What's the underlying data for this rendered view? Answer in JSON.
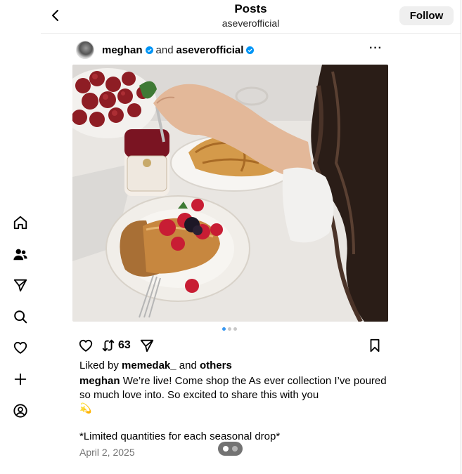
{
  "header": {
    "title": "Posts",
    "subtitle": "aseverofficial",
    "follow_label": "Follow"
  },
  "sidebar": {
    "items": [
      {
        "icon": "home-icon"
      },
      {
        "icon": "people-icon"
      },
      {
        "icon": "send-icon"
      },
      {
        "icon": "search-icon"
      },
      {
        "icon": "heart-icon"
      },
      {
        "icon": "plus-icon"
      },
      {
        "icon": "profile-icon"
      }
    ]
  },
  "post": {
    "author": "meghan",
    "and_text": "and",
    "coauthor": "aseverofficial",
    "verified_color": "#0095f6",
    "repost_count": "63",
    "carousel": {
      "total": 3,
      "current": 1
    },
    "likes_prefix": "Liked by",
    "liked_by": "memedak_",
    "likes_and": "and",
    "likes_others": "others",
    "caption_author": "meghan",
    "caption_text": "We’re live! Come shop the As ever collection I’ve poured so much love into. So excited to share this with you",
    "caption_emoji": "💫",
    "limited_text": "*Limited quantities for each seasonal drop*",
    "date": "April 2, 2025"
  }
}
